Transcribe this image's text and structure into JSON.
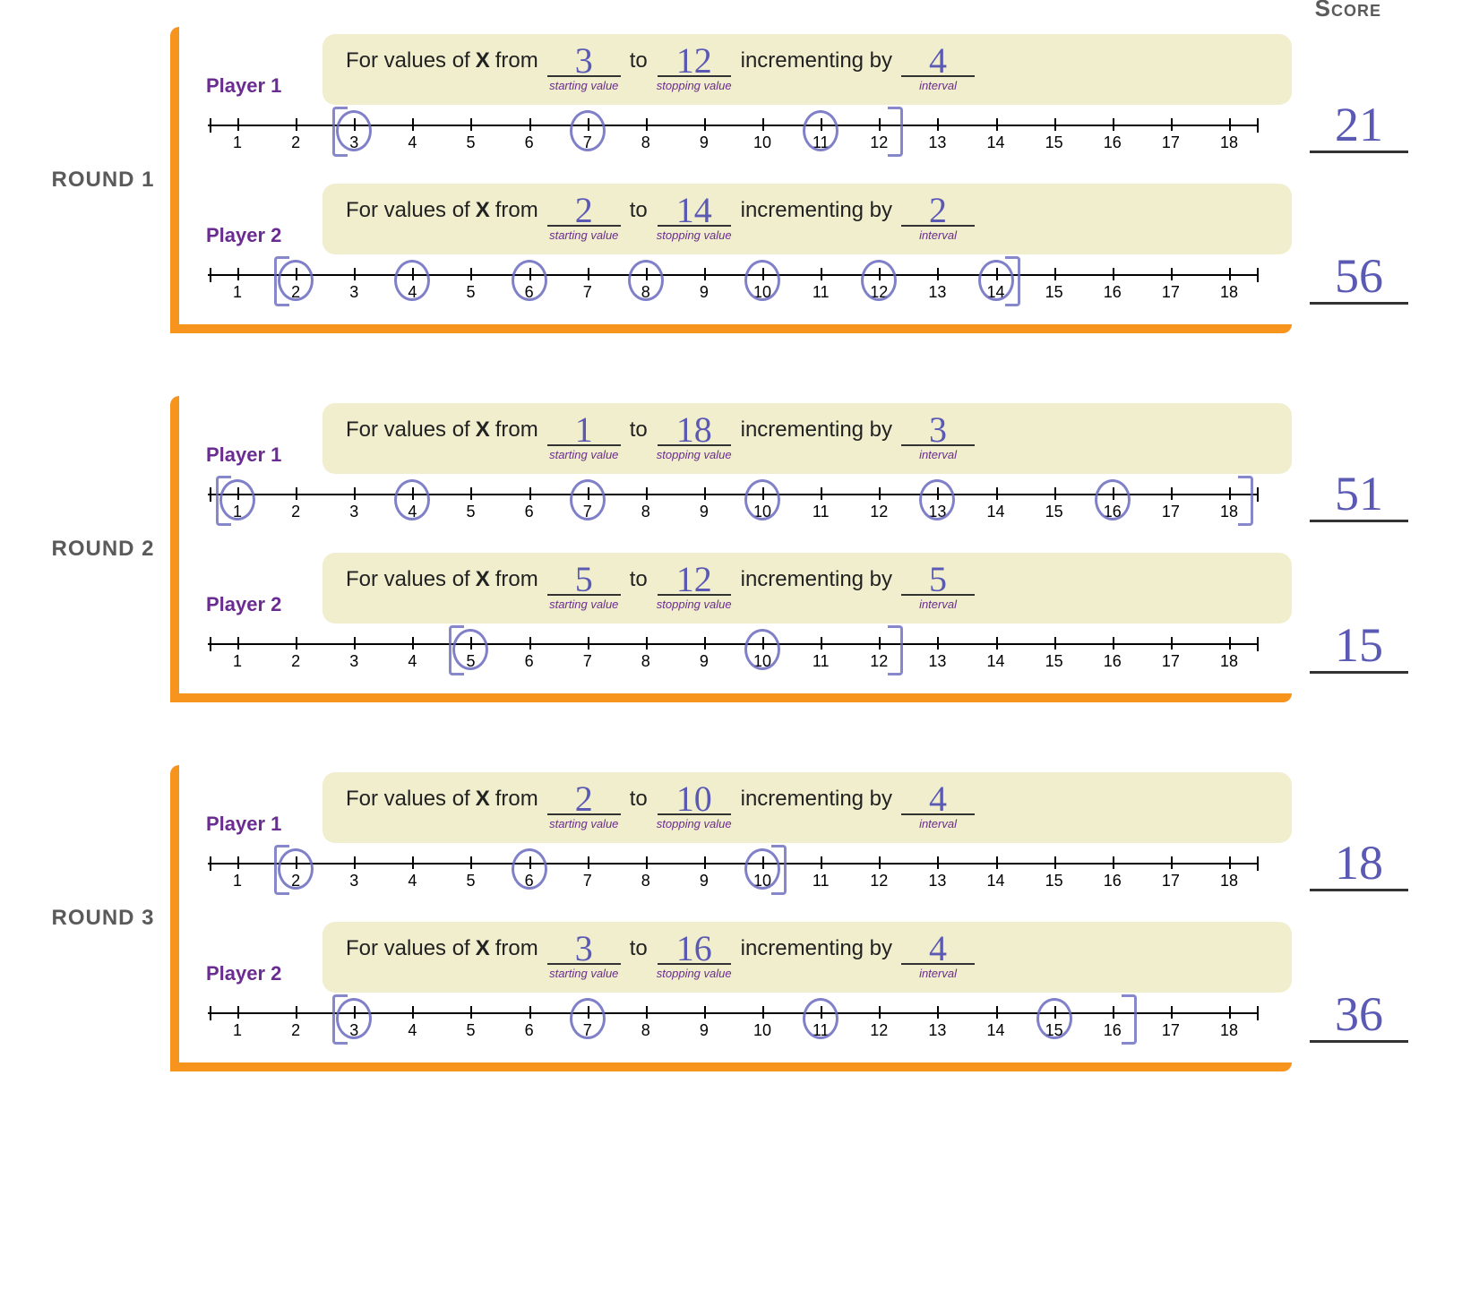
{
  "scoreLabel": "Score",
  "template": {
    "prefix": "For values of",
    "var": "X",
    "from": "from",
    "to": "to",
    "inc": "incrementing by",
    "sub_start": "starting value",
    "sub_stop": "stopping value",
    "sub_int": "interval"
  },
  "numberLine": {
    "min": 1,
    "max": 18
  },
  "rounds": [
    {
      "label": "ROUND 1",
      "players": [
        {
          "name": "Player 1",
          "start": "3",
          "stop": "12",
          "interval": "4",
          "circled": [
            3,
            7,
            11
          ],
          "bracketStart": 3,
          "bracketEnd": 12,
          "score": "21"
        },
        {
          "name": "Player 2",
          "start": "2",
          "stop": "14",
          "interval": "2",
          "circled": [
            2,
            4,
            6,
            8,
            10,
            12,
            14
          ],
          "bracketStart": 2,
          "bracketEnd": 14,
          "score": "56"
        }
      ]
    },
    {
      "label": "ROUND 2",
      "players": [
        {
          "name": "Player 1",
          "start": "1",
          "stop": "18",
          "interval": "3",
          "circled": [
            1,
            4,
            7,
            10,
            13,
            16
          ],
          "bracketStart": 1,
          "bracketEnd": 18,
          "score": "51"
        },
        {
          "name": "Player 2",
          "start": "5",
          "stop": "12",
          "interval": "5",
          "circled": [
            5,
            10
          ],
          "bracketStart": 5,
          "bracketEnd": 12,
          "score": "15"
        }
      ]
    },
    {
      "label": "ROUND 3",
      "players": [
        {
          "name": "Player 1",
          "start": "2",
          "stop": "10",
          "interval": "4",
          "circled": [
            2,
            6,
            10
          ],
          "bracketStart": 2,
          "bracketEnd": 10,
          "score": "18"
        },
        {
          "name": "Player 2",
          "start": "3",
          "stop": "16",
          "interval": "4",
          "circled": [
            3,
            7,
            11,
            15
          ],
          "bracketStart": 3,
          "bracketEnd": 16,
          "score": "36"
        }
      ]
    }
  ]
}
